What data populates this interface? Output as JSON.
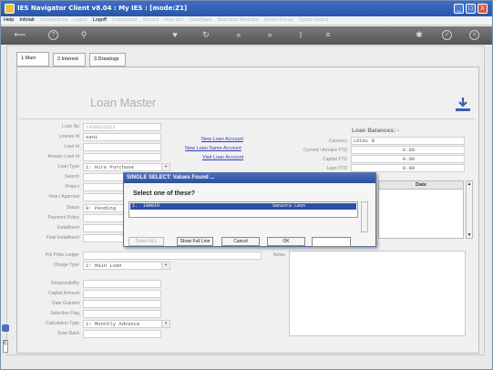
{
  "window": {
    "title": "IES Navigator Client v8.04 : My IES :      [mode:Z1]",
    "buttons": [
      "_",
      "□",
      "X"
    ]
  },
  "menu": {
    "items": [
      "Help",
      "Infolab",
      "Connections",
      "Logon",
      "Logoff",
      "Companies",
      "Wizard",
      "How do I",
      "DataMarts",
      "Business Modules",
      "Action Focus",
      "Option Select"
    ]
  },
  "tabs": [
    "1.Main",
    "2.Interest",
    "3.Drawings"
  ],
  "form": {
    "title": "Loan Master",
    "fields": {
      "loan_no": {
        "label": "Loan No",
        "value": "1459631521"
      },
      "loanee_id": {
        "label": "Loanee Id",
        "value": "sani"
      },
      "loan_id": {
        "label": "Loan Id",
        "value": ""
      },
      "arrears_loan_id": {
        "label": "Arrears Loan Id",
        "value": ""
      },
      "loan_type": {
        "label": "Loan Type",
        "value": "1: Hire Purchase"
      },
      "search": {
        "label": "Search",
        "value": ""
      },
      "project": {
        "label": "Project",
        "value": ""
      },
      "vote_approval": {
        "label": "Vote / Approval",
        "value": ""
      },
      "status": {
        "label": "Status",
        "value": "0: Pending"
      },
      "payment_policy": {
        "label": "Payment Policy",
        "value": ""
      },
      "installment": {
        "label": "Installment",
        "value": ""
      },
      "final_installment": {
        "label": "Final Installment",
        "value": ""
      },
      "pol_pmts_ledger": {
        "label": "Pol Pmts Ledger",
        "value": ""
      },
      "charge_type": {
        "label": "Charge Type",
        "value": "1: Main Loan"
      },
      "responsibility": {
        "label": "Responsibility",
        "value": ""
      },
      "capital_amount": {
        "label": "Capital Amount",
        "value": ""
      },
      "date_granted": {
        "label": "Date Granted",
        "value": ""
      },
      "selection_flag": {
        "label": "Selection Flag",
        "value": ""
      },
      "calculation_type": {
        "label": "Calculation Type",
        "value": "1: Monthly Advance"
      },
      "scan_back": {
        "label": "Scan Back",
        "value": ""
      }
    },
    "links": {
      "new_loan_account": "New Loan Account",
      "new_loan_same_account": "New Loan Same Account",
      "visit_loan_account": "Visit Loan Account"
    },
    "balances": {
      "heading": "Loan Balances: -",
      "currency": {
        "label": "Currency",
        "value": "LOCAL R"
      },
      "current_arrears": {
        "label": "Current / Arrears YTD",
        "value": "0.00"
      },
      "capital_ytd": {
        "label": "Capital YTD",
        "value": "0.00"
      },
      "loan_ytd": {
        "label": "Loan YTD",
        "value": "0.00"
      }
    },
    "table_header": "Date",
    "notes_label": "Notes"
  },
  "dialog": {
    "title": "SINGLE SELECT: Values Found ...",
    "prompt": "Select one of these?",
    "rows": [
      {
        "index": "1.",
        "code": "100019",
        "name": "Saniora Leon"
      }
    ],
    "buttons": {
      "select_all": "Select ALL",
      "show_full_line": "Show Full Line",
      "cancel": "Cancel",
      "ok": "OK"
    }
  },
  "colors": {
    "titlebar": "#2f5cb3",
    "link": "#3040b8",
    "selection": "#2b50a8"
  }
}
